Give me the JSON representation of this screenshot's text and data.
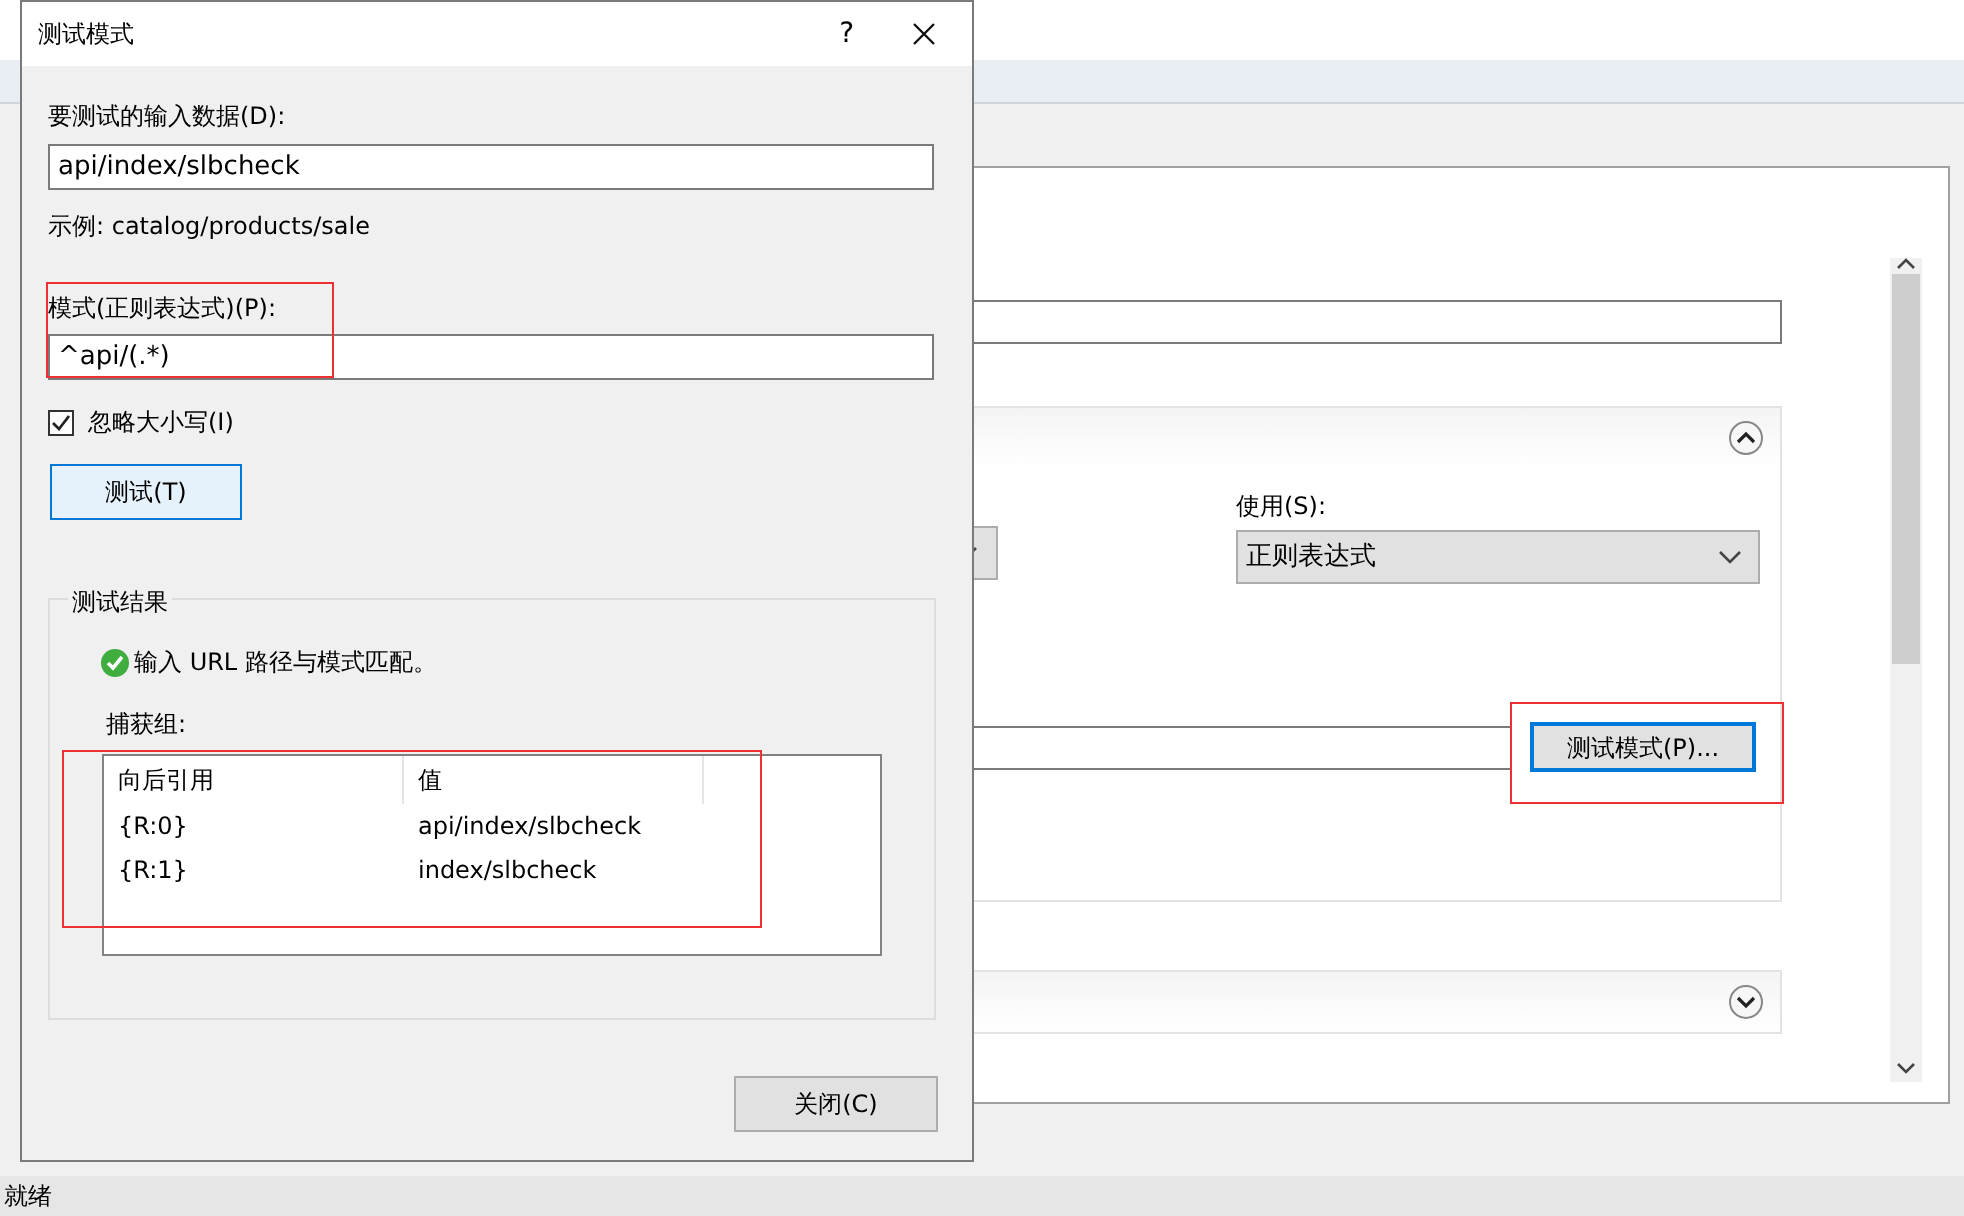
{
  "dialog": {
    "title": "测试模式",
    "help_glyph": "?",
    "input_label": "要测试的输入数据(D):",
    "input_value": "api/index/slbcheck",
    "example": "示例: catalog/products/sale",
    "pattern_label": "模式(正则表达式)(P):",
    "pattern_value": "^api/(.*)",
    "pattern_highlighted": true,
    "ignore_case": {
      "label": "忽略大小写(I)",
      "checked": true
    },
    "test_button": "测试(T)",
    "results": {
      "title": "测试结果",
      "message": "输入 URL 路径与模式匹配。",
      "success": true,
      "capture_label": "捕获组:",
      "highlighted": true,
      "columns": [
        "向后引用",
        "值"
      ],
      "rows": [
        [
          "{R:0}",
          "api/index/slbcheck"
        ],
        [
          "{R:1}",
          "index/slbcheck"
        ]
      ]
    },
    "close_button": "关闭(C)"
  },
  "background": {
    "use_label": "使用(S):",
    "use_value": "正则表达式",
    "test_pattern_button": "测试模式(P)...",
    "test_pattern_highlighted": true,
    "panels": [
      {
        "expanded": true
      },
      {
        "expanded": false
      }
    ]
  },
  "status_bar": "就绪"
}
